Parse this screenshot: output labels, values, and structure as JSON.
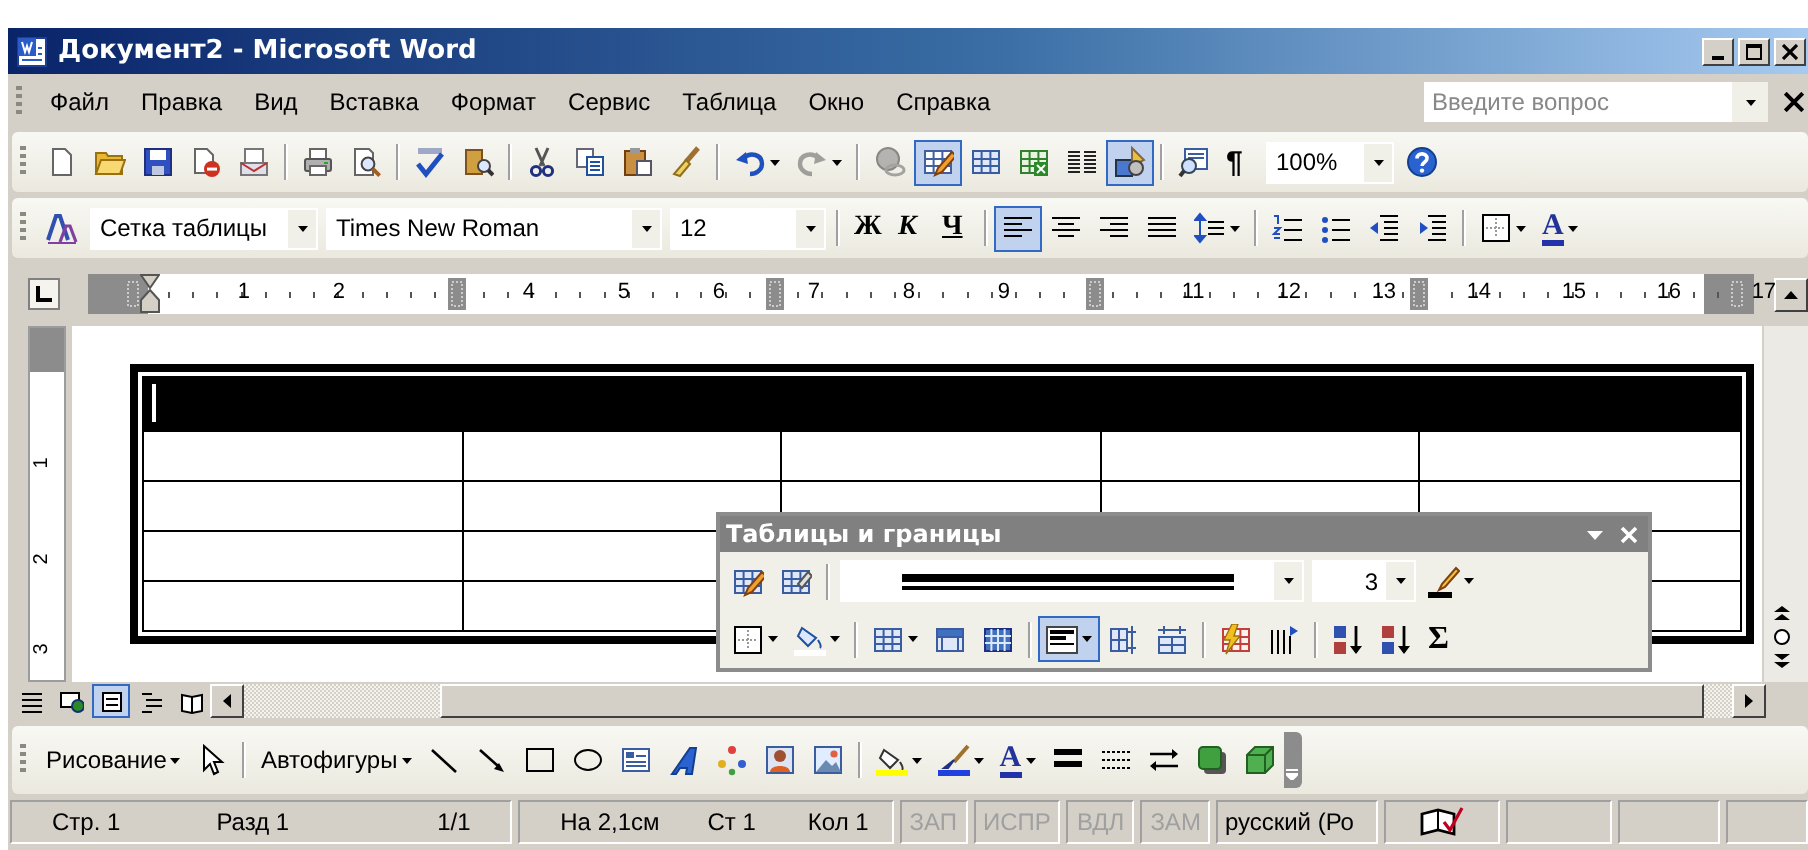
{
  "window": {
    "title": "Документ2 - Microsoft Word"
  },
  "menu": [
    "Файл",
    "Правка",
    "Вид",
    "Вставка",
    "Формат",
    "Сервис",
    "Таблица",
    "Окно",
    "Справка"
  ],
  "help_box": {
    "placeholder": "Введите вопрос"
  },
  "standard_toolbar": {
    "buttons": [
      {
        "pressed": false,
        "disabled": false
      },
      {
        "pressed": false,
        "disabled": false
      },
      {
        "pressed": false,
        "disabled": false
      },
      {
        "pressed": false,
        "disabled": false
      },
      {
        "pressed": false,
        "disabled": false
      },
      {
        "pressed": false,
        "disabled": false
      },
      {
        "pressed": false,
        "disabled": false
      },
      {
        "pressed": false,
        "disabled": false
      },
      {
        "pressed": false,
        "disabled": false
      },
      {
        "pressed": false,
        "disabled": false
      },
      {
        "pressed": false,
        "disabled": false
      },
      {
        "pressed": false,
        "disabled": false
      },
      {
        "pressed": false,
        "disabled": false
      },
      {
        "pressed": false,
        "disabled": false
      },
      {
        "pressed": false,
        "disabled": true
      },
      {
        "pressed": false,
        "disabled": true
      },
      {
        "pressed": true,
        "disabled": false
      },
      {
        "pressed": false,
        "disabled": false
      },
      {
        "pressed": false,
        "disabled": false
      },
      {
        "pressed": false,
        "disabled": false
      },
      {
        "pressed": true,
        "disabled": false
      },
      {
        "pressed": false,
        "disabled": false
      },
      {
        "pressed": false,
        "disabled": false
      },
      {
        "pressed": false,
        "disabled": false
      }
    ],
    "labels": [
      "¶"
    ],
    "zoom": "100%"
  },
  "formatting_toolbar": {
    "style": "Сетка таблицы",
    "font": "Times New Roman",
    "size": "12",
    "buttons": [
      {
        "pressed": false
      },
      {
        "pressed": false
      },
      {
        "pressed": false
      },
      {
        "pressed": false
      },
      {
        "pressed": true
      },
      {
        "pressed": false
      },
      {
        "pressed": false
      },
      {
        "pressed": false
      },
      {
        "pressed": false
      },
      {
        "pressed": false
      },
      {
        "pressed": false
      },
      {
        "pressed": false
      },
      {
        "pressed": false
      },
      {
        "pressed": false
      },
      {
        "pressed": false
      }
    ],
    "labels": [
      "Ж",
      "К",
      "Ч",
      "A"
    ]
  },
  "ruler": {
    "labels": [
      "1",
      "2",
      "4",
      "5",
      "6",
      "7",
      "8",
      "9",
      "11",
      "12",
      "13",
      "14",
      "15",
      "16",
      "17"
    ]
  },
  "vertical_ruler": {
    "labels": [
      "1",
      "2",
      "3"
    ]
  },
  "table": {
    "rows": [
      {
        "selected": true
      },
      {
        "selected": false
      },
      {
        "selected": false
      },
      {
        "selected": false
      },
      {
        "selected": false
      }
    ]
  },
  "tables_toolbar": {
    "title": "Таблицы и границы",
    "line_weight": "3",
    "buttons": [
      {
        "pressed": false
      },
      {
        "pressed": false
      },
      {
        "pressed": false
      },
      {
        "pressed": false
      },
      {
        "pressed": false
      },
      {
        "pressed": false
      },
      {
        "pressed": false
      },
      {
        "pressed": false
      },
      {
        "pressed": true
      },
      {
        "pressed": false
      },
      {
        "pressed": false
      },
      {
        "pressed": false
      },
      {
        "pressed": false
      },
      {
        "pressed": false
      },
      {
        "pressed": false
      },
      {
        "pressed": false
      }
    ],
    "labels": [
      "Σ"
    ]
  },
  "view_buttons": [
    {
      "selected": false
    },
    {
      "selected": false
    },
    {
      "selected": true
    },
    {
      "selected": false
    },
    {
      "selected": false
    }
  ],
  "drawing_toolbar": {
    "labels": [
      "Рисование",
      "Автофигуры",
      "A"
    ]
  },
  "status_bar": {
    "fields": [
      "Стр. 1",
      "Разд 1",
      "1/1",
      "На 2,1см",
      "Ст 1",
      "Кол 1"
    ],
    "modes": [
      {
        "label": "ЗАП",
        "on": false
      },
      {
        "label": "ИСПР",
        "on": false
      },
      {
        "label": "ВДЛ",
        "on": false
      },
      {
        "label": "ЗАМ",
        "on": false
      }
    ],
    "language": "русский (Ро"
  }
}
